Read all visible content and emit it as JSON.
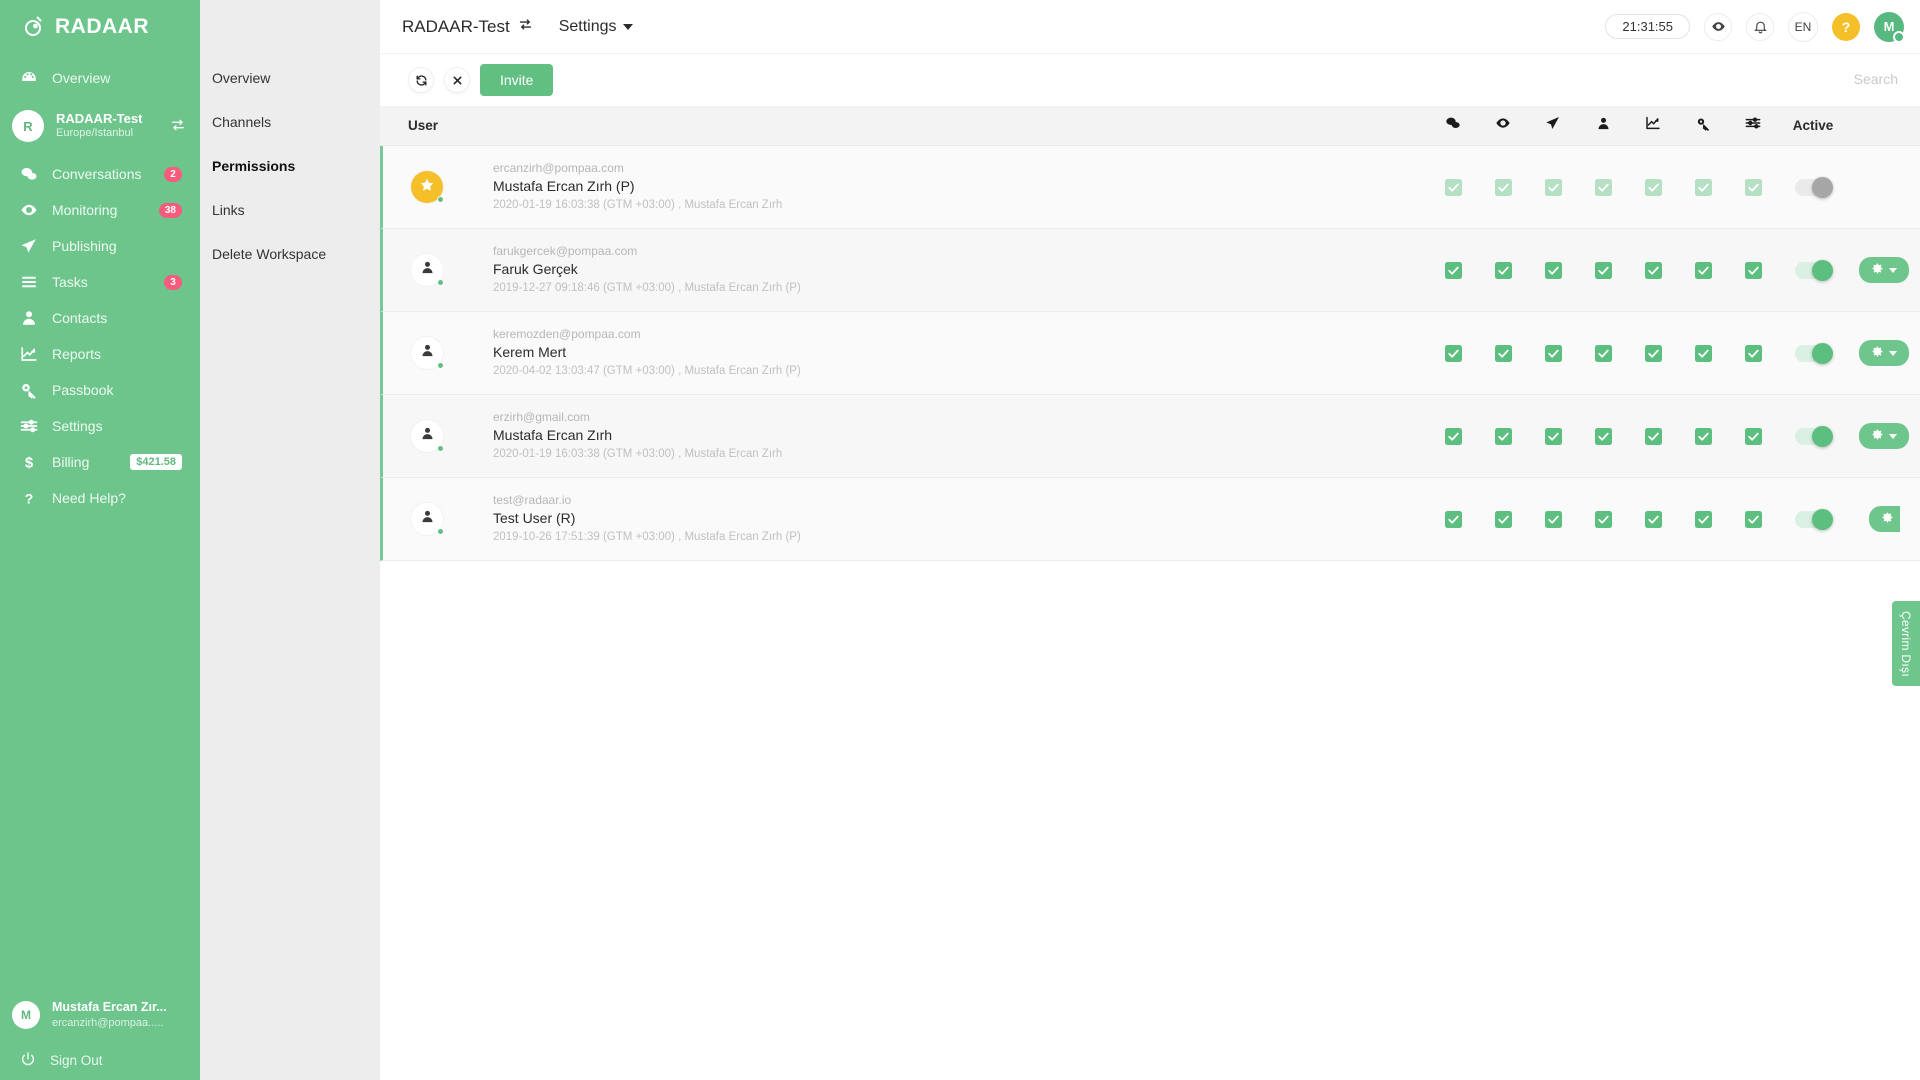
{
  "brand": {
    "name": "RADAAR",
    "logo_icon": "radaar-logo-icon"
  },
  "sidebar": {
    "items": [
      {
        "label": "Overview",
        "icon": "dashboard-icon",
        "badge": ""
      },
      {
        "label": "Conversations",
        "icon": "chat-icon",
        "badge": "2"
      },
      {
        "label": "Monitoring",
        "icon": "eye-icon",
        "badge": "38"
      },
      {
        "label": "Publishing",
        "icon": "send-icon",
        "badge": ""
      },
      {
        "label": "Tasks",
        "icon": "list-icon",
        "badge": "3"
      },
      {
        "label": "Contacts",
        "icon": "person-icon",
        "badge": ""
      },
      {
        "label": "Reports",
        "icon": "chart-icon",
        "badge": ""
      },
      {
        "label": "Passbook",
        "icon": "key-icon",
        "badge": ""
      },
      {
        "label": "Settings",
        "icon": "sliders-icon",
        "badge": ""
      }
    ],
    "billing": {
      "label": "Billing",
      "icon": "dollar-icon",
      "amount": "$421.58"
    },
    "help": {
      "label": "Need Help?",
      "icon": "question-icon"
    },
    "workspace": {
      "initial": "R",
      "name": "RADAAR-Test",
      "timezone": "Europe/Istanbul",
      "swap_icon": "swap-icon"
    },
    "profile": {
      "initial": "M",
      "name": "Mustafa Ercan Zır...",
      "email": "ercanzirh@pompaa....."
    },
    "sign_out": {
      "label": "Sign Out",
      "icon": "power-icon"
    }
  },
  "subnav": {
    "items": [
      {
        "label": "Overview",
        "active": false
      },
      {
        "label": "Channels",
        "active": false
      },
      {
        "label": "Permissions",
        "active": true
      },
      {
        "label": "Links",
        "active": false
      },
      {
        "label": "Delete Workspace",
        "active": false
      }
    ]
  },
  "topbar": {
    "workspace_title": "RADAAR-Test",
    "workspace_swap_icon": "swap-icon",
    "menu_label": "Settings",
    "clock": "21:31:55",
    "eye_icon": "eye-icon",
    "bell_icon": "bell-icon",
    "language": "EN",
    "help_badge": "?",
    "user_initial": "M"
  },
  "toolbar": {
    "refresh_icon": "refresh-icon",
    "close_icon": "close-icon",
    "invite_label": "Invite",
    "search_placeholder": "Search",
    "search_value": ""
  },
  "table": {
    "user_column_label": "User",
    "active_column_label": "Active",
    "permission_columns": [
      {
        "name": "conversations",
        "icon": "chat-icon"
      },
      {
        "name": "monitoring",
        "icon": "eye-icon"
      },
      {
        "name": "publishing",
        "icon": "send-icon"
      },
      {
        "name": "contacts",
        "icon": "person-icon"
      },
      {
        "name": "reports",
        "icon": "chart-icon"
      },
      {
        "name": "passbook",
        "icon": "key-icon"
      },
      {
        "name": "settings",
        "icon": "sliders-icon"
      }
    ],
    "rows": [
      {
        "avatar_type": "star",
        "avatar_initial": "",
        "email": "ercanzirh@pompaa.com",
        "name": "Mustafa Ercan Zırh (P)",
        "meta": "2020-01-19 16:03:38 (GTM +03:00) , Mustafa Ercan Zırh",
        "permissions": [
          true,
          true,
          true,
          true,
          true,
          true,
          true
        ],
        "permissions_disabled": true,
        "active": false,
        "active_disabled": true,
        "has_gear": false,
        "gear_clipped": false,
        "online": true
      },
      {
        "avatar_type": "person",
        "avatar_initial": "",
        "email": "farukgercek@pompaa.com",
        "name": "Faruk Gerçek",
        "meta": "2019-12-27 09:18:46 (GTM +03:00) , Mustafa Ercan Zırh (P)",
        "permissions": [
          true,
          true,
          true,
          true,
          true,
          true,
          true
        ],
        "permissions_disabled": false,
        "active": true,
        "active_disabled": false,
        "has_gear": true,
        "gear_clipped": false,
        "online": true
      },
      {
        "avatar_type": "person",
        "avatar_initial": "",
        "email": "keremozden@pompaa.com",
        "name": "Kerem Mert",
        "meta": "2020-04-02 13:03:47 (GTM +03:00) , Mustafa Ercan Zırh (P)",
        "permissions": [
          true,
          true,
          true,
          true,
          true,
          true,
          true
        ],
        "permissions_disabled": false,
        "active": true,
        "active_disabled": false,
        "has_gear": true,
        "gear_clipped": false,
        "online": true
      },
      {
        "avatar_type": "person",
        "avatar_initial": "",
        "email": "erzirh@gmail.com",
        "name": "Mustafa Ercan Zırh",
        "meta": "2020-01-19 16:03:38 (GTM +03:00) , Mustafa Ercan Zırh",
        "permissions": [
          true,
          true,
          true,
          true,
          true,
          true,
          true
        ],
        "permissions_disabled": false,
        "active": true,
        "active_disabled": false,
        "has_gear": true,
        "gear_clipped": false,
        "online": true
      },
      {
        "avatar_type": "person",
        "avatar_initial": "",
        "email": "test@radaar.io",
        "name": "Test User (R)",
        "meta": "2019-10-26 17:51:39 (GTM +03:00) , Mustafa Ercan Zırh (P)",
        "permissions": [
          true,
          true,
          true,
          true,
          true,
          true,
          true
        ],
        "permissions_disabled": false,
        "active": true,
        "active_disabled": false,
        "has_gear": true,
        "gear_clipped": true,
        "online": true
      }
    ]
  },
  "side_tab": {
    "label": "Çevrim Dışı"
  },
  "colors": {
    "brand_green": "#6dc58c",
    "accent_green": "#62bf82",
    "badge_red": "#f75c7e",
    "star_yellow": "#f5bf2a"
  }
}
